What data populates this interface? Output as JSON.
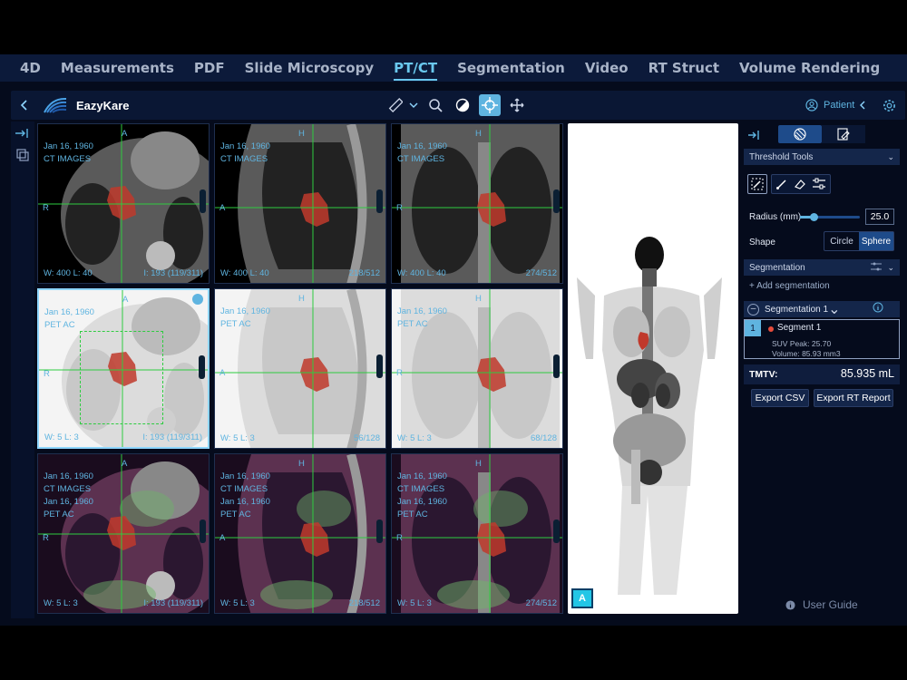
{
  "tabs": [
    {
      "label": "4D"
    },
    {
      "label": "Measurements"
    },
    {
      "label": "PDF"
    },
    {
      "label": "Slide Microscopy"
    },
    {
      "label": "PT/CT",
      "active": true
    },
    {
      "label": "Segmentation"
    },
    {
      "label": "Video"
    },
    {
      "label": "RT Struct"
    },
    {
      "label": "Volume Rendering"
    }
  ],
  "toolbar": {
    "app_name": "EazyKare",
    "patient_label": "Patient",
    "tools": [
      "ruler-icon",
      "zoom-icon",
      "contrast-icon",
      "crosshair-icon",
      "pan-icon"
    ]
  },
  "viewports": [
    {
      "date": "Jan 16, 1960",
      "series": [
        "CT IMAGES"
      ],
      "top": "A",
      "left": "R",
      "wl": "W: 400  L: 40",
      "index": "I: 193 (119/311)"
    },
    {
      "date": "Jan 16, 1960",
      "series": [
        "CT IMAGES"
      ],
      "top": "H",
      "left": "A",
      "wl": "W: 400  L: 40",
      "index": "218/512"
    },
    {
      "date": "Jan 16, 1960",
      "series": [
        "CT IMAGES"
      ],
      "top": "H",
      "left": "R",
      "wl": "W: 400  L: 40",
      "index": "274/512"
    },
    {
      "date": "Jan 16, 1960",
      "series": [
        "PET AC"
      ],
      "top": "A",
      "left": "R",
      "wl": "W: 5  L: 3",
      "index": "I: 193 (119/311)"
    },
    {
      "date": "Jan 16, 1960",
      "series": [
        "PET AC"
      ],
      "top": "H",
      "left": "A",
      "wl": "W: 5  L: 3",
      "index": "56/128"
    },
    {
      "date": "Jan 16, 1960",
      "series": [
        "PET AC"
      ],
      "top": "H",
      "left": "R",
      "wl": "W: 5  L: 3",
      "index": "68/128"
    },
    {
      "date": "Jan 16, 1960",
      "series": [
        "CT IMAGES",
        "Jan 16, 1960",
        "PET AC"
      ],
      "top": "A",
      "left": "R",
      "wl": "W: 5  L: 3",
      "index": "I: 193 (119/311)"
    },
    {
      "date": "Jan 16, 1960",
      "series": [
        "CT IMAGES",
        "Jan 16, 1960",
        "PET AC"
      ],
      "top": "H",
      "left": "A",
      "wl": "W: 5  L: 3",
      "index": "218/512"
    },
    {
      "date": "Jan 16, 1960",
      "series": [
        "CT IMAGES",
        "Jan 16, 1960",
        "PET AC"
      ],
      "top": "H",
      "left": "R",
      "wl": "W: 5  L: 3",
      "index": "274/512"
    }
  ],
  "mip": {
    "orientation": "A"
  },
  "panel": {
    "threshold_tools": "Threshold Tools",
    "radius_label": "Radius (mm)",
    "radius_value": "25.0",
    "radius_fraction": 0.22,
    "shape_label": "Shape",
    "shape_options": [
      "Circle",
      "Sphere"
    ],
    "shape_selected": "Sphere",
    "segmentation_header": "Segmentation",
    "add_segmentation": "+ Add segmentation",
    "segmentation_name": "Segmentation 1",
    "segment_index": "1",
    "segment_name": "Segment 1",
    "suv_peak": "SUV Peak: 25.70",
    "volume": "Volume: 85.93 mm3",
    "tmtv_label": "TMTV:",
    "tmtv_value": "85.935 mL",
    "export_csv": "Export CSV",
    "export_rt": "Export RT Report",
    "user_guide": "User Guide"
  },
  "colors": {
    "accent": "#5fb4e0",
    "segment": "#c0392b",
    "crosshair": "#2ecc40",
    "panel_bg": "#0a1734"
  }
}
